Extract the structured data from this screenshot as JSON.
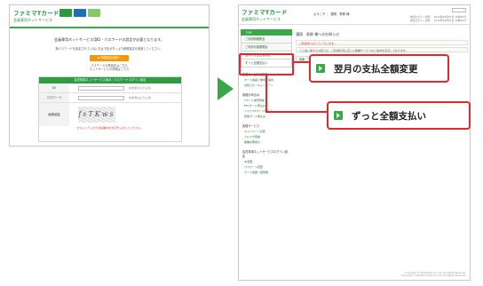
{
  "left": {
    "logo": "ファミマTカード",
    "logo_sub": "会員専用ネットサービス",
    "title": "会員専用ネットサービス用ID・パスワードの設定が必要となります。",
    "sub1": "新パスワードを設定されていない方は下記ボタンより新規設定を実施してください。",
    "button": "▶ 新規設定画面へ",
    "link1": "パスワードの再設定はこちら",
    "link2": "ネットサービスの詳細はこちら",
    "form_header": "会員専用ネットサービス用ID・パスワード ログイン設定",
    "field_id": "ID",
    "field_pw": "パスワード",
    "field_auth": "画像認証",
    "note": "(6文字以上で入力)",
    "captcha": "fsTKws",
    "footer_red": "セキュリティのため画像内の文字を入力してください。"
  },
  "right": {
    "logo": "ファミマTカード",
    "logo_sub": "会員専用ネットサービス",
    "user": "ようこそ ： 漢翔　寿郎 様",
    "dates": [
      "前回ログイン日時 ： 2014年09月01日 10時20分",
      "本日ログイン日時 ： 2014年09月01日 10時29分"
    ],
    "home": "TOP",
    "side_items": [
      "ご利用明細照会",
      "ご利用可能額照会",
      "翌月の支払全額変更",
      "ずっと全額支払い"
    ],
    "groups": [
      {
        "title": "各種サービスご案内",
        "links": [
          "カード会員ご優待ご案内",
          "お知らせ・キャンペーン"
        ]
      },
      {
        "title": "各種お申込み",
        "links": [
          "Tカード番号登録",
          "ETCカード申込み",
          "ファミマTカード申込み",
          "家族カード申込み"
        ]
      },
      {
        "title": "各種サービス",
        "links": [
          "キャンペーン応募",
          "メルマガ登録",
          "各種お問合せ"
        ]
      },
      {
        "title": "会員専用ネットサービスログイン設定",
        "links": [
          "ID変更",
          "パスワード変更",
          "カード会員一括登録"
        ]
      }
    ],
    "page_title": "漢翔　寿郎 様へのお知らせ",
    "notices": [
      "ご利用ありがとうございます。",
      "ご入会に関するお知らせ、ご利用状況に応じた各種サービスのご案内を表示しております。"
    ],
    "tabs": [
      "重要",
      "キャンペーン",
      "その他"
    ],
    "footer": [
      "Copyright © FamilyMart Co.,Ltd. All Rights Reserved.",
      "Copyright © POCKET CARD Co.,Ltd. All Rights Reserved."
    ]
  },
  "callouts": {
    "first": "翌月の支払全額変更",
    "second": "ずっと全額支払い"
  },
  "colors": {
    "brand_green": "#3aa84a",
    "highlight_red": "#e4262d",
    "button_orange": "#f39800"
  }
}
